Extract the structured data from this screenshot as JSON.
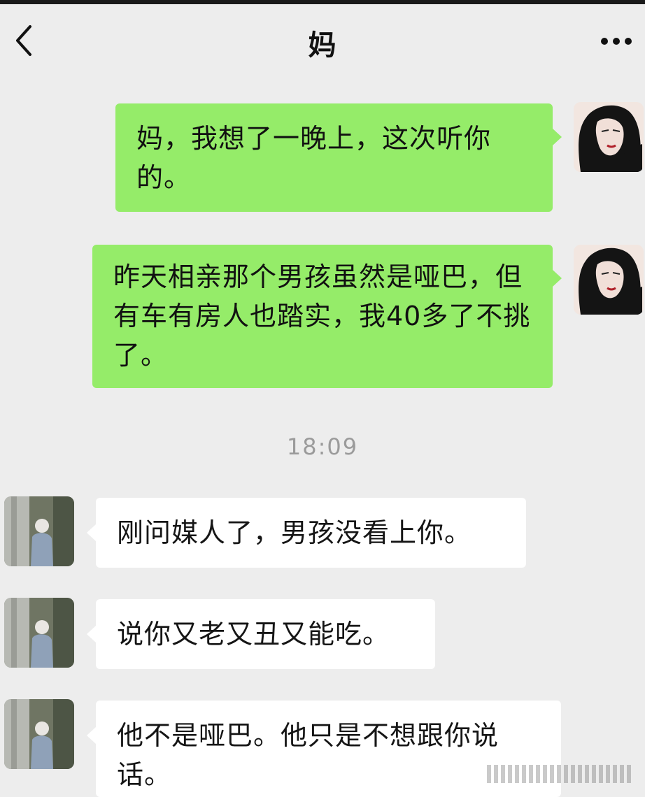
{
  "header": {
    "title": "妈",
    "back_icon": "chevron-left-icon",
    "more_icon": "more-dots-icon"
  },
  "messages": [
    {
      "side": "sent",
      "text": "妈，我想了一晚上，这次听你的。"
    },
    {
      "side": "sent",
      "text": "昨天相亲那个男孩虽然是哑巴，但有车有房人也踏实，我40多了不挑了。"
    },
    {
      "side": "received",
      "text": "刚问媒人了，男孩没看上你。"
    },
    {
      "side": "received",
      "text": "说你又老又丑又能吃。"
    },
    {
      "side": "received",
      "text": "他不是哑巴。他只是不想跟你说话。"
    }
  ],
  "timestamp": "18:09",
  "colors": {
    "background": "#ededed",
    "sent_bubble": "#95ec69",
    "received_bubble": "#ffffff",
    "timestamp_text": "#9b9b9b"
  }
}
